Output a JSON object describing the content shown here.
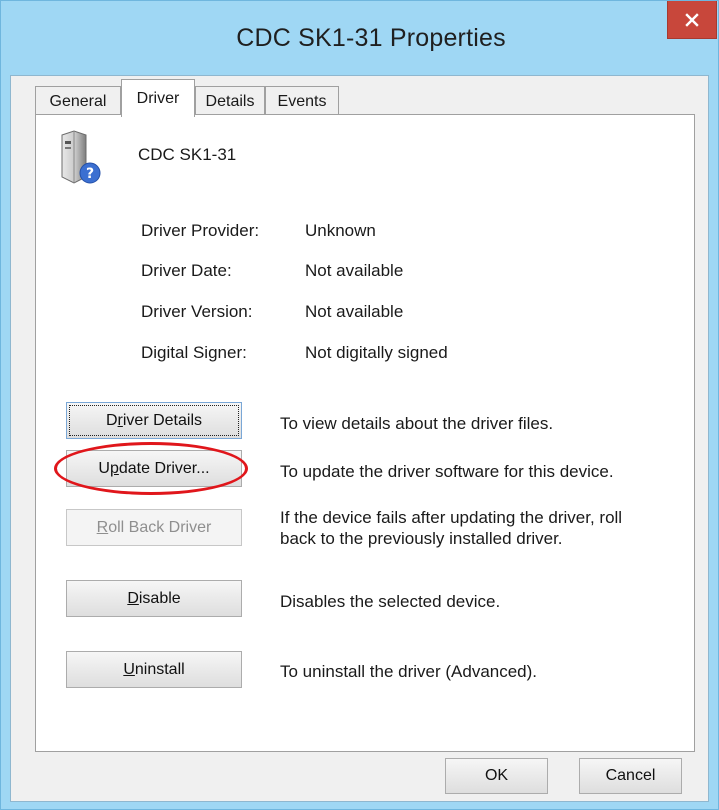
{
  "window": {
    "title": "CDC SK1-31 Properties",
    "close_glyph": "×"
  },
  "tabs": [
    {
      "label": "General",
      "active": false
    },
    {
      "label": "Driver",
      "active": true
    },
    {
      "label": "Details",
      "active": false
    },
    {
      "label": "Events",
      "active": false
    }
  ],
  "device": {
    "icon": "unknown-device-icon",
    "name": "CDC SK1-31"
  },
  "properties": [
    {
      "label": "Driver Provider:",
      "value": "Unknown"
    },
    {
      "label": "Driver Date:",
      "value": "Not available"
    },
    {
      "label": "Driver Version:",
      "value": "Not available"
    },
    {
      "label": "Digital Signer:",
      "value": "Not digitally signed"
    }
  ],
  "actions": [
    {
      "label_pre": "D",
      "label_u": "r",
      "label_post": "iver Details",
      "description": "To view details about the driver files.",
      "enabled": true,
      "focused": true
    },
    {
      "label_pre": "U",
      "label_u": "p",
      "label_post": "date Driver...",
      "description": "To update the driver software for this device.",
      "enabled": true,
      "highlighted": true
    },
    {
      "label_pre": "",
      "label_u": "R",
      "label_post": "oll Back Driver",
      "description_line1": "If the device fails after updating the driver, roll",
      "description_line2": "back to the previously installed driver.",
      "enabled": false
    },
    {
      "label_pre": "",
      "label_u": "D",
      "label_post": "isable",
      "description": "Disables the selected device.",
      "enabled": true
    },
    {
      "label_pre": "",
      "label_u": "U",
      "label_post": "ninstall",
      "description": "To uninstall the driver (Advanced).",
      "enabled": true
    }
  ],
  "footer": {
    "ok_label": "OK",
    "cancel_label": "Cancel"
  },
  "colors": {
    "titlebar": "#9fd7f4",
    "close_button": "#c8473b",
    "highlight_ring": "#e0161b"
  }
}
